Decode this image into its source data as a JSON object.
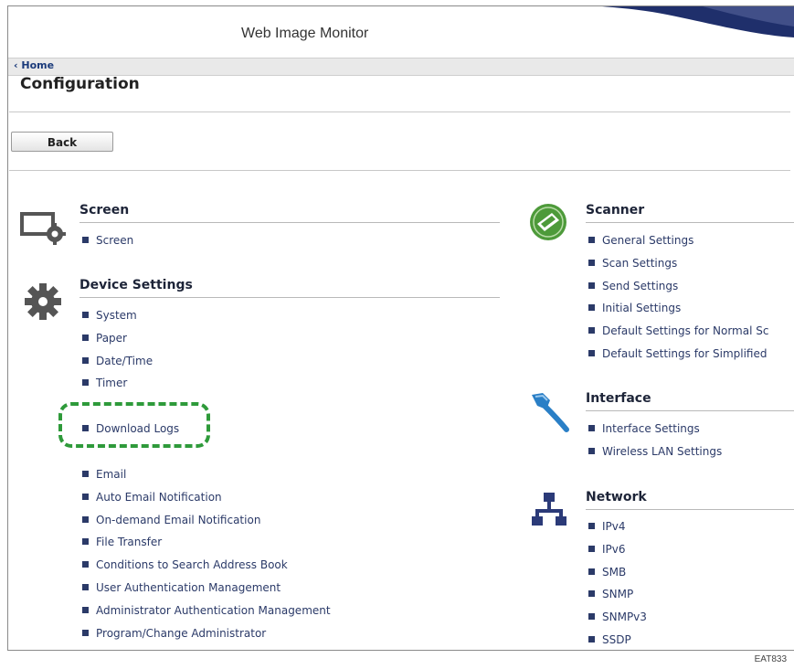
{
  "window": {
    "title": "Web Image Monitor"
  },
  "breadcrumb": {
    "home": "Home"
  },
  "page": {
    "title": "Configuration",
    "back_label": "Back"
  },
  "left": {
    "screen": {
      "heading": "Screen",
      "icon": "monitor-gear-icon",
      "links": [
        "Screen"
      ]
    },
    "device": {
      "heading": "Device Settings",
      "icon": "gear-icon",
      "links_a": [
        "System",
        "Paper",
        "Date/Time",
        "Timer"
      ],
      "highlighted_link": "Download Logs",
      "links_b": [
        "Email",
        "Auto Email Notification",
        "On-demand Email Notification",
        "File Transfer",
        "Conditions to Search Address Book",
        "User Authentication Management",
        "Administrator Authentication Management",
        "Program/Change Administrator"
      ]
    }
  },
  "right": {
    "scanner": {
      "heading": "Scanner",
      "icon": "scanner-icon",
      "links": [
        "General Settings",
        "Scan Settings",
        "Send Settings",
        "Initial Settings",
        "Default Settings for Normal Sc",
        "Default Settings for Simplified"
      ]
    },
    "interface": {
      "heading": "Interface",
      "icon": "cable-icon",
      "links": [
        "Interface Settings",
        "Wireless LAN Settings"
      ]
    },
    "network": {
      "heading": "Network",
      "icon": "network-icon",
      "links": [
        "IPv4",
        "IPv6",
        "SMB",
        "SNMP",
        "SNMPv3",
        "SSDP"
      ]
    }
  },
  "figure_code": "EAT833",
  "colors": {
    "link": "#2b3a68",
    "highlight": "#2e9a3a",
    "scanner_icon": "#4d9a3a",
    "interface_icon": "#2a7fc6",
    "network_icon": "#2b3a78"
  }
}
